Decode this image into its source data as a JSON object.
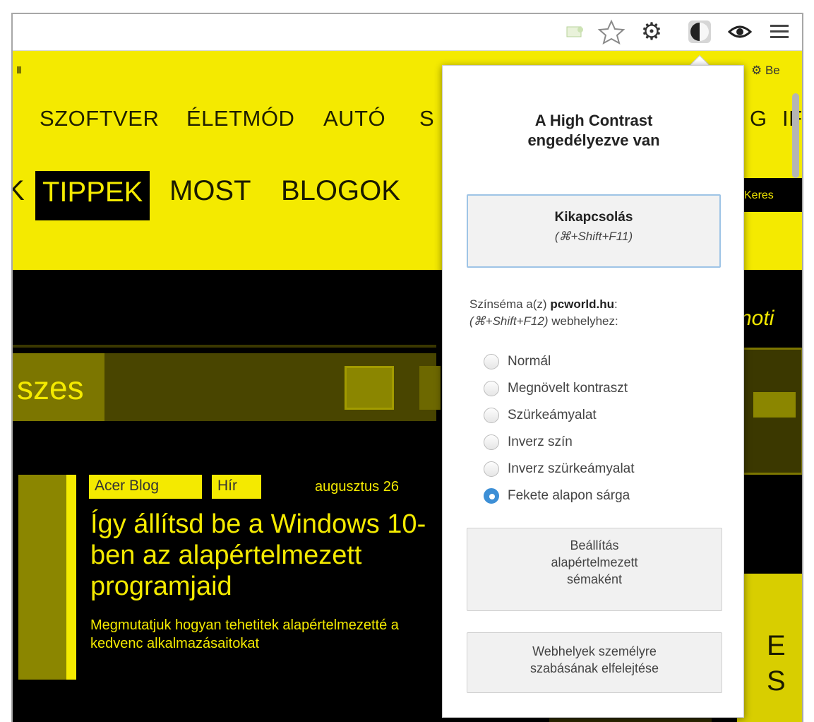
{
  "toolbar": {
    "icons": [
      "plugin-icon",
      "star-icon",
      "gear-icon",
      "high-contrast-icon",
      "eye-icon",
      "menu-icon"
    ]
  },
  "page": {
    "top_link": "Be",
    "nav_primary": [
      "SZOFTVER",
      "ÉLETMÓD",
      "AUTÓ",
      "S",
      "G",
      "IF"
    ],
    "nav_secondary": [
      "TIPPEK",
      "MOST",
      "BLOGOK"
    ],
    "search_label": "Keres",
    "section_title": "szes",
    "side_text": "noti",
    "article": {
      "tag1": "Acer Blog",
      "tag2": "Hír",
      "date": "augusztus 26",
      "headline": "Így állítsd be a Windows 10-ben az alapértelmezett programjaid",
      "summary": "Megmutatjuk hogyan tehetitek alapértelmezetté a kedvenc alkalmazásaitokat"
    },
    "side_letters": [
      "E",
      "S"
    ]
  },
  "popup": {
    "title_line1": "A High Contrast",
    "title_line2": "engedélyezve van",
    "disable_label": "Kikapcsolás",
    "disable_shortcut": "(⌘+Shift+F11)",
    "scheme_prefix": "Színséma a(z) ",
    "scheme_site": "pcworld.hu",
    "scheme_suffix": ":",
    "scheme_shortcut": "(⌘+Shift+F12)",
    "scheme_target": " webhelyhez:",
    "options": [
      {
        "label": "Normál",
        "selected": false
      },
      {
        "label": "Megnövelt kontraszt",
        "selected": false
      },
      {
        "label": "Szürkeámyalat",
        "selected": false
      },
      {
        "label": "Inverz szín",
        "selected": false
      },
      {
        "label": "Inverz szürkeámyalat",
        "selected": false
      },
      {
        "label": "Fekete alapon sárga",
        "selected": true
      }
    ],
    "set_default_l1": "Beállítás",
    "set_default_l2": "alapértelmezett",
    "set_default_l3": "sémaként",
    "forget_l1": "Webhelyek személyre",
    "forget_l2": "szabásának elfelejtése"
  },
  "colors": {
    "page_yellow": "#f4ea00",
    "page_black": "#000000",
    "accent_blue": "#3d8fd6"
  }
}
